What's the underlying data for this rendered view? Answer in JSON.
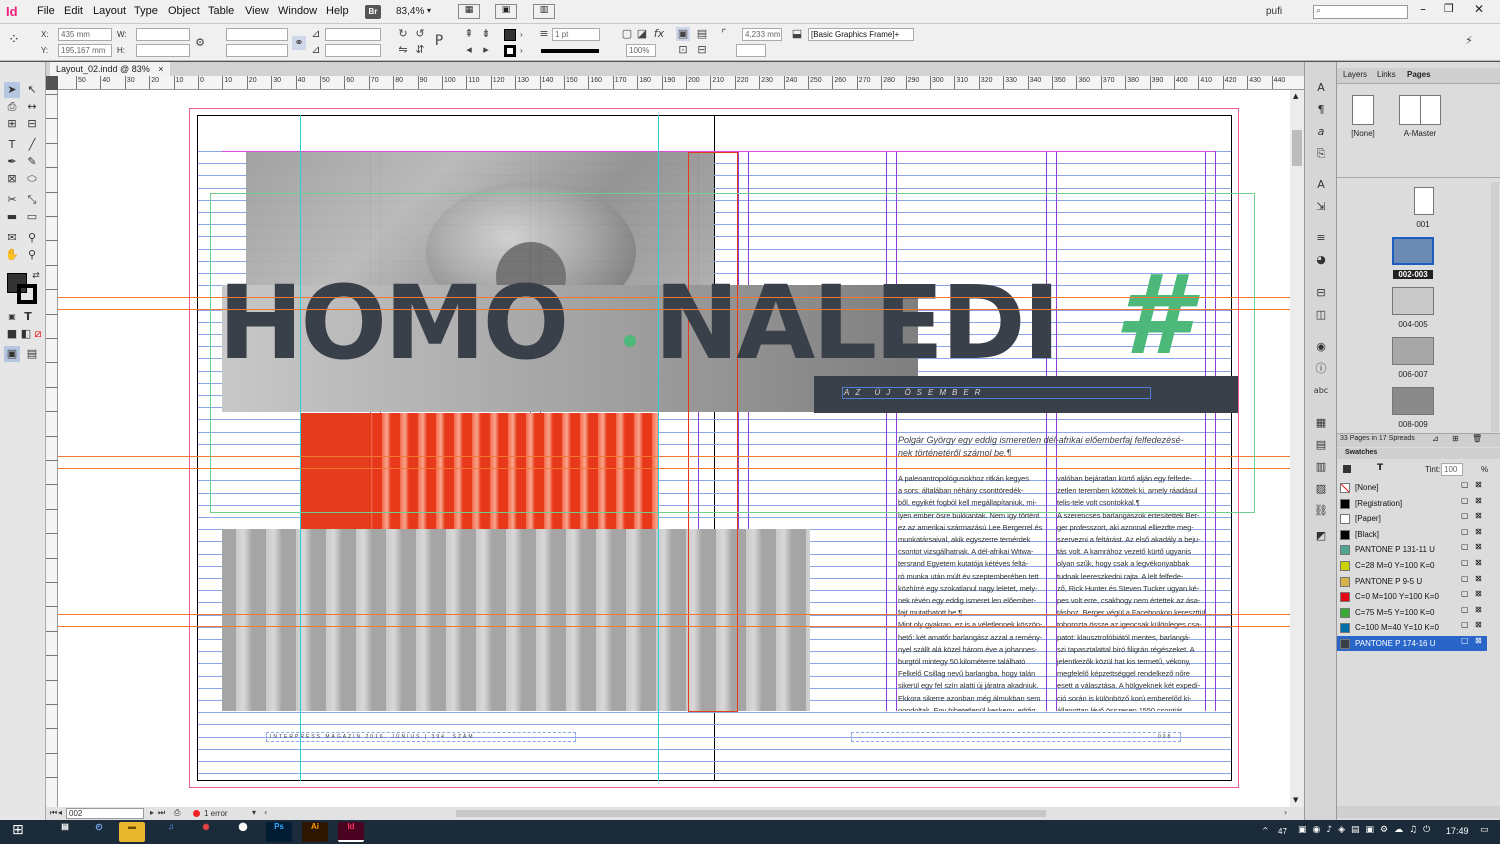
{
  "app": {
    "logo": "Id",
    "menus": [
      "File",
      "Edit",
      "Layout",
      "Type",
      "Object",
      "Table",
      "View",
      "Window",
      "Help"
    ],
    "bridge": "Br",
    "zoom": "83,4%",
    "user": "pufi"
  },
  "control": {
    "x_label": "X:",
    "x": "435 mm",
    "y_label": "Y:",
    "y": "195,167 mm",
    "w_label": "W:",
    "h_label": "H:",
    "stroke": "1 pt",
    "scale": "100%",
    "size": "4,233 mm",
    "style": "[Basic Graphics Frame]+"
  },
  "document": {
    "tab": "Layout_02.indd @ 83%",
    "close": "×"
  },
  "ruler": {
    "h_ticks": [
      "50",
      "40",
      "30",
      "20",
      "10",
      "0",
      "10",
      "20",
      "30",
      "40",
      "50",
      "60",
      "70",
      "80",
      "90",
      "100",
      "110",
      "120",
      "130",
      "140",
      "150",
      "160",
      "170",
      "180",
      "190",
      "200",
      "210",
      "220",
      "230",
      "240",
      "250",
      "260",
      "270",
      "280",
      "290",
      "300",
      "310",
      "320",
      "330",
      "340",
      "350",
      "360",
      "370",
      "380",
      "390",
      "400",
      "410",
      "420",
      "430",
      "440"
    ]
  },
  "spread": {
    "title_left": "HOMO",
    "title_right": "NALEDI",
    "hash": "#",
    "subtitle": "AZ ÚJ ŐSEMBER",
    "lead": "Polgár György egy eddig ismeretlen dél-afrikai előemberfaj felfedezésé-\nnek történetéről számol be.¶",
    "col1": "A paleoantropológusokhoz ritkán kegyes\na sors: általában néhány csonttöredék-\nből, egyikét fogból kell megállapítaniuk, mi-\nlyen ember ősre bukkantak. Nem így történt\nez az amerikai származású Lee Bergerrel és\nmunkatársaival, akik egyszerre temérdek\ncsontot vizsgálhatnak. A dél-afrikai Witwa-\ntersrand Egyetem kutatója kétéves feltá-\nró munka után múlt év szeptemberében tett\nközhírré egy szokatlanul nagy leletet, mely-\nnek révén egy eddig ismeret len előember-\nfajt mutathatott be.¶\nMint oly gyakran, ez is a véletlennek köszön-\nhető: két amatőr barlangász azzal a remény-\nnyel szállt alá közel három éve a johannes-\nburgtól mintegy 50 kilométerre található\nFelkelő Csillag nevű barlangba, hogy talán\nsikerül egy fel szín alatti új járatra akadniuk.\nEkkora sikerre azonban még álmukban sem\ngondoltak. Egy hihetetlenül keskeny, eddig",
    "col2": "valóban bejáratlan kürtő alján egy felfede-\nzetlen teremben kötöttek ki, amely ráadásul\ntelis-tele volt csontokkal.¶\nA szerencsés barlangászok értesítették Ber-\nger professzort, aki azonnal elliezdte meg-\nszervezni a feltárást. Az első akadály a beju-\ntás volt. A kamrához vezető kürtő ugyanis\nolyan szűk, hogy csak a legvékonyabbak\ntudnak leereszkedni rajta. A lelt felfede-\nző, Rick Hunter és Steven Tucker ugyan ké-\npes volt erre, csakhogy nem értettek az ása-\ntáshoz. Berger végül a Facebookon kereszttül\ntoborozta össze az igencsak különleges csa-\npatot: klausztrofóbiától mentes, barlangá-\nszi tapasztalattal bíró filigrán régészeket. A\njelentkezők közül hat kis termetű, vékony,\nmegfelelő képzettséggel rendelkező nőre\nesett a választása. A hölgyeknek két expedí-\nció során is különböző korú emberelőd ki-\nállapottan lévő összesen 1550 csontját",
    "folio_left": "INTERPRESS MAGAZIN 2016. JÚNIUS | 394. SZÁM",
    "folio_right": "008"
  },
  "status": {
    "page": "002",
    "errors": "1 error"
  },
  "panels": {
    "tabs": [
      "Layers",
      "Links",
      "Pages"
    ],
    "masters": [
      {
        "label": "[None]"
      },
      {
        "label": "A-Master"
      }
    ],
    "pages": [
      {
        "label": "001"
      },
      {
        "label": "002-003"
      },
      {
        "label": "004-005"
      },
      {
        "label": "006-007"
      },
      {
        "label": "008-009"
      }
    ],
    "pages_info": "33 Pages in 17 Spreads",
    "swatches_title": "Swatches",
    "tint_label": "Tint:",
    "tint": "100",
    "pct": "%",
    "swatches": [
      {
        "name": "[None]",
        "color": "#ffffff"
      },
      {
        "name": "[Registration]",
        "color": "#000000"
      },
      {
        "name": "[Paper]",
        "color": "#ffffff"
      },
      {
        "name": "[Black]",
        "color": "#000000"
      },
      {
        "name": "PANTONE P 131-11 U",
        "color": "#4fa58f"
      },
      {
        "name": "C=28 M=0 Y=100 K=0",
        "color": "#c8d400"
      },
      {
        "name": "PANTONE P 9-5 U",
        "color": "#d7b24a"
      },
      {
        "name": "C=0 M=100 Y=100 K=0",
        "color": "#e30613"
      },
      {
        "name": "C=75 M=5 Y=100 K=0",
        "color": "#3aa935"
      },
      {
        "name": "C=100 M=40 Y=10 K=0",
        "color": "#006fa9"
      },
      {
        "name": "PANTONE P 174-16 U",
        "color": "#3a4049"
      }
    ]
  },
  "taskbar": {
    "time": "17:49",
    "badge": "47"
  },
  "colors": {
    "title": "#3a4049",
    "accent_green": "#4cb87a",
    "red": "#e63c1e",
    "grey_img": "#9a9a9a"
  }
}
